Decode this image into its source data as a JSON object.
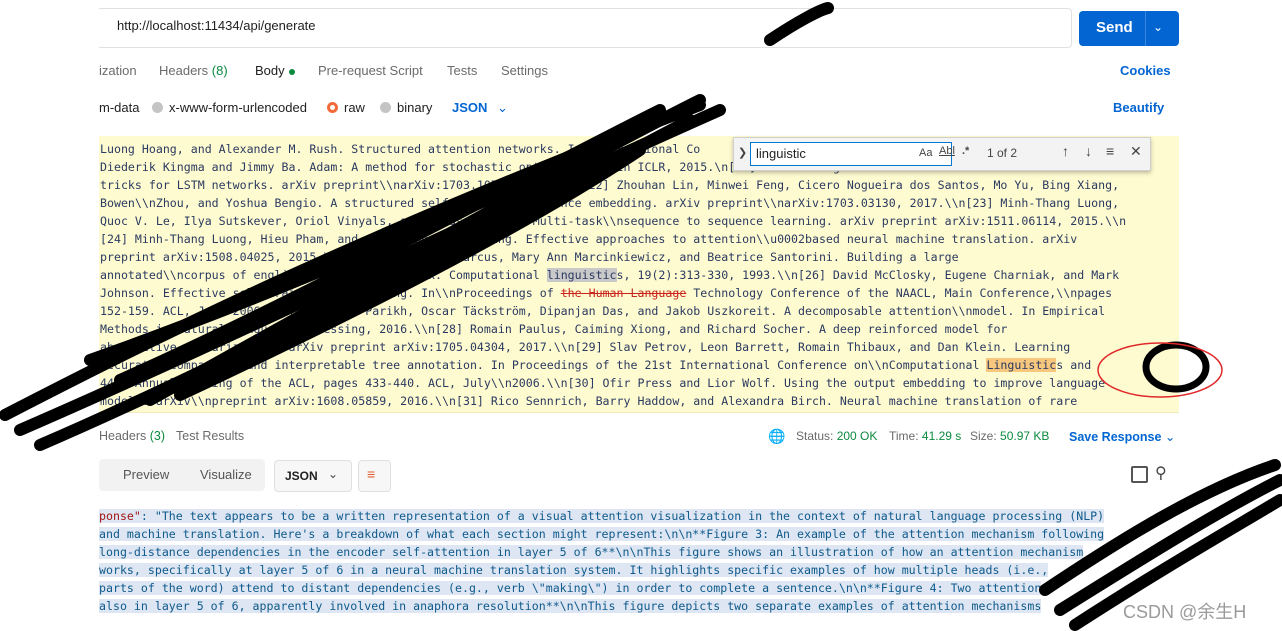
{
  "request": {
    "url": "http://localhost:11434/api/generate",
    "send_label": "Send"
  },
  "request_tabs": [
    {
      "label": "ization",
      "count": ""
    },
    {
      "label": "Headers",
      "count": "(8)"
    },
    {
      "label": "Body",
      "count": ""
    },
    {
      "label": "Pre-request Script",
      "count": ""
    },
    {
      "label": "Tests",
      "count": ""
    },
    {
      "label": "Settings",
      "count": ""
    }
  ],
  "cookies_label": "Cookies",
  "body_types": [
    "m-data",
    "x-www-form-urlencoded",
    "raw",
    "binary"
  ],
  "body_format": "JSON",
  "beautify_label": "Beautify",
  "find": {
    "query": "linguistic",
    "match_case": "Aa",
    "whole_word": "Abl",
    "regex": ".*",
    "count": "1 of 2"
  },
  "body_lines": [
    "Luong Hoang, and Alexander M. Rush. Structured attention networks. In International Co",
    "Diederik Kingma and Jimmy Ba. Adam: A method for stochastic optimization. In ICLR, 2015.\\n[22] Zichao Yang and Scott Randomized:",
    "tricks for LSTM networks. arXiv preprint\\\\narXiv:1703.10722, 2017.\\\\n[22] Zhouhan Lin, Minwei Feng, Cicero Nogueira dos Santos, Mo Yu, Bing Xiang,",
    "Bowen\\\\nZhou, and Yoshua Bengio. A structured self-attentive sentence embedding. arXiv preprint\\\\narXiv:1703.03130, 2017.\\\\n[23] Minh-Thang Luong,",
    "Quoc V. Le, Ilya Sutskever, Oriol Vinyals, and Lukasz Kaiser. Multi-task\\\\nsequence to sequence learning. arXiv preprint arXiv:1511.06114, 2015.\\\\n",
    "[24] Minh-Thang Luong, Hieu Pham, and Christopher D Manning. Effective approaches to attention\\\\u0002based neural machine translation. arXiv",
    "preprint arXiv:1508.04025, 2015.\\\\n[25] Mitchell P Marcus, Mary Ann Marcinkiewicz, and Beatrice Santorini. Building a large",
    {
      "pre": "annotated\\\\ncorpus of english: The penn treebank. Computational ",
      "hl": "linguistic",
      "post": "s, 19(2):313-330, 1993.\\\\n[26] David McClosky, Eugene Charniak, and Mark"
    },
    {
      "pre": "Johnson. Effective self-training for parsing. In\\\\nProceedings of ",
      "strike": "the Human Language",
      "post": " Technology Conference of the NAACL, Main Conference,\\\\npages"
    },
    "152-159. ACL, June 2006.\\\\n[27] Ankur Parikh, Oscar Täckström, Dipanjan Das, and Jakob Uszkoreit. A decomposable attention\\\\nmodel. In Empirical",
    "Methods in Natural Language Processing, 2016.\\\\n[28] Romain Paulus, Caiming Xiong, and Richard Socher. A deep reinforced model for",
    "abstractive summarization. arXiv preprint arXiv:1705.04304, 2017.\\\\n[29] Slav Petrov, Leon Barrett, Romain Thibaux, and Dan Klein. Learning",
    {
      "pre": "accurate, compact,\\\\nand interpretable tree annotation. In Proceedings of the 21st International Conference on\\\\nComputational ",
      "hl": "Linguistic",
      "post": "s and"
    },
    "44th Annual Meeting of the ACL, pages 433-440. ACL, July\\\\n2006.\\\\n[30] Ofir Press and Lior Wolf. Using the output embedding to improve language",
    "models. arXiv\\\\npreprint arXiv:1608.05859, 2016.\\\\n[31] Rico Sennrich, Barry Haddow, and Alexandra Birch. Neural machine translation of rare"
  ],
  "response_tabs": [
    {
      "label": "Headers",
      "count": "(3)"
    },
    {
      "label": "Test Results",
      "count": ""
    }
  ],
  "response_status": {
    "status_label": "Status:",
    "status_value": "200 OK",
    "time_label": "Time:",
    "time_value": "41.29 s",
    "size_label": "Size:",
    "size_value": "50.97 KB",
    "save_label": "Save Response"
  },
  "response_views": [
    "Preview",
    "Visualize"
  ],
  "response_format": "JSON",
  "response_key": "ponse\"",
  "response_lines": [
    ": \"The text appears to be a written representation of a visual attention visualization in the context of natural language processing (NLP)",
    "and machine translation. Here's a breakdown of what each section might represent:\\n\\n**Figure 3: An example of the attention mechanism following",
    "long-distance dependencies in the encoder self-attention in layer 5 of 6**\\n\\nThis figure shows an illustration of how an attention mechanism",
    "works, specifically at layer 5 of 6 in a neural machine translation system. It highlights specific examples of how multiple heads (i.e.,",
    "parts of the word) attend to distant dependencies (e.g., verb \\\"making\\\") in order to complete a sentence.\\n\\n**Figure 4: Two attention",
    "also in layer 5 of 6, apparently involved in anaphora resolution**\\n\\nThis figure depicts two separate examples of attention mechanisms"
  ],
  "watermark": "CSDN @余生H",
  "colors": {
    "accent": "#0265d2",
    "send": "#0265d2",
    "editor_bg": "#fffbd0",
    "status_ok": "#0c8a3f",
    "annotation": "#e0282a"
  }
}
